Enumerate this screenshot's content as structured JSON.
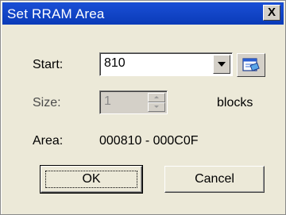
{
  "window": {
    "title": "Set RRAM Area",
    "close_label": "X"
  },
  "form": {
    "start": {
      "label": "Start:",
      "value": "810"
    },
    "size": {
      "label": "Size:",
      "value": "1",
      "unit": "blocks"
    },
    "area": {
      "label": "Area:",
      "value": "000810 - 000C0F"
    }
  },
  "buttons": {
    "ok": "OK",
    "cancel": "Cancel"
  },
  "icons": {
    "start_picker": "memory-map-icon",
    "combo_dropdown": "chevron-down-icon",
    "spin_up": "spin-up-icon",
    "spin_down": "spin-down-icon"
  },
  "colors": {
    "titlebar": "#0a3bb8",
    "dialog_bg": "#ece9d8"
  }
}
